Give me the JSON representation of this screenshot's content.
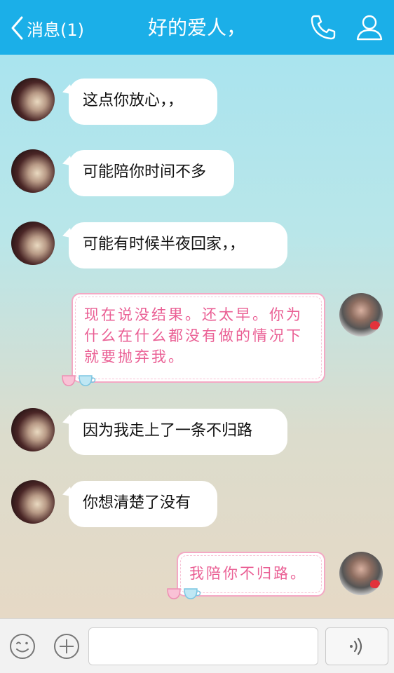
{
  "header": {
    "back_label": "消息(1)",
    "title": "好的爱人，"
  },
  "messages": [
    {
      "sender": "her",
      "text": "这点你放心，，"
    },
    {
      "sender": "her",
      "text": "可能陪你时间不多"
    },
    {
      "sender": "her",
      "text": "可能有时候半夜回家，，"
    },
    {
      "sender": "me",
      "lines": [
        "现在说没结果。还太早。你为",
        "什么在什么都没有做的情况下",
        "就要抛弃我。"
      ]
    },
    {
      "sender": "her",
      "text": "因为我走上了一条不归路"
    },
    {
      "sender": "her",
      "text": "你想清楚了没有"
    },
    {
      "sender": "me",
      "lines": [
        "我陪你不归路。"
      ]
    }
  ],
  "input": {
    "placeholder": ""
  },
  "colors": {
    "header": "#1bafe8",
    "pink_text": "#ea5f94",
    "pink_border": "#f4a8c4"
  },
  "icons": {
    "back": "chevron-left-icon",
    "call": "phone-icon",
    "profile": "person-icon",
    "emoji": "smiley-icon",
    "plus": "plus-icon",
    "voice": "voice-wave-icon"
  }
}
